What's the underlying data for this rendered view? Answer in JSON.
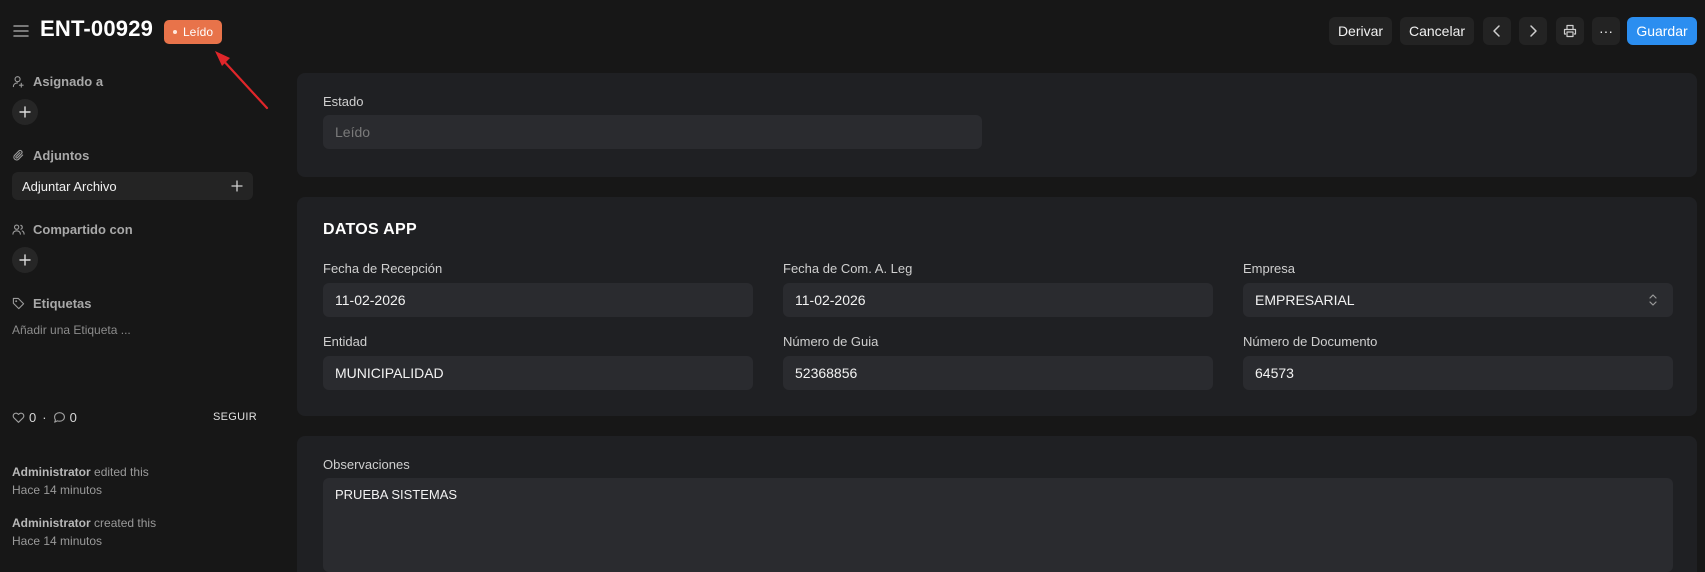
{
  "header": {
    "title": "ENT-00929",
    "status": "Leído",
    "actions": {
      "derivar": "Derivar",
      "cancelar": "Cancelar",
      "more": "···",
      "guardar": "Guardar"
    }
  },
  "sidebar": {
    "assigned_label": "Asignado a",
    "attachments_label": "Adjuntos",
    "attach_file": "Adjuntar Archivo",
    "shared_label": "Compartido con",
    "tags_label": "Etiquetas",
    "add_tag": "Añadir una Etiqueta ...",
    "likes": "0",
    "separator": "·",
    "comments": "0",
    "follow": "SEGUIR",
    "activity": [
      {
        "user": "Administrator",
        "action": "edited this",
        "time": "Hace 14 minutos"
      },
      {
        "user": "Administrator",
        "action": "created this",
        "time": "Hace 14 minutos"
      }
    ]
  },
  "form": {
    "estado": {
      "label": "Estado",
      "value": "Leído"
    },
    "section_title": "DATOS APP",
    "fecha_recepcion": {
      "label": "Fecha de Recepción",
      "value": "11-02-2026"
    },
    "fecha_com": {
      "label": "Fecha de Com. A. Leg",
      "value": "11-02-2026"
    },
    "empresa": {
      "label": "Empresa",
      "value": "EMPRESARIAL"
    },
    "entidad": {
      "label": "Entidad",
      "value": "MUNICIPALIDAD"
    },
    "numero_guia": {
      "label": "Número de Guia",
      "value": "52368856"
    },
    "numero_documento": {
      "label": "Número de Documento",
      "value": "64573"
    },
    "observaciones": {
      "label": "Observaciones",
      "value": "PRUEBA SISTEMAS"
    }
  },
  "colors": {
    "status_pill": "#e8734a",
    "primary_button": "#2b8ef0",
    "annotation_arrow": "#e0262a"
  }
}
